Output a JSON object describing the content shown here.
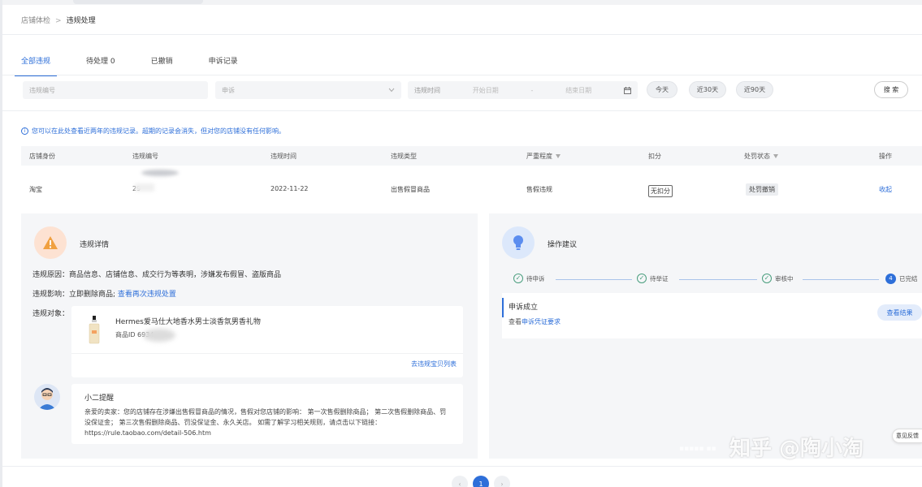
{
  "breadcrumb": {
    "parent": "店铺体检",
    "separator": ">",
    "current": "违规处理"
  },
  "tabs": [
    {
      "label": "全部违规"
    },
    {
      "label": "待处理 0"
    },
    {
      "label": "已撤销"
    },
    {
      "label": "申诉记录"
    }
  ],
  "filters": {
    "id_placeholder": "违规编号",
    "type_value": "申诉",
    "time_label": "违规时间",
    "start_placeholder": "开始日期",
    "range_sep": "-",
    "end_placeholder": "结束日期",
    "quick": [
      "今天",
      "近30天",
      "近90天"
    ],
    "search_label": "搜 索"
  },
  "notice": "您可以在此处查看近两年的违规记录。超期的记录会消失，但对您的店铺没有任何影响。",
  "table": {
    "headers": [
      "店铺身份",
      "违规编号",
      "违规时间",
      "违规类型",
      "严重程度",
      "扣分",
      "处罚状态",
      "操作"
    ],
    "row": {
      "identity": "淘宝",
      "id": "29",
      "time": "2022-11-22",
      "type": "出售假冒商品",
      "severity": "售假违规",
      "points": "无扣分",
      "status": "处罚撤销",
      "action": "收起"
    }
  },
  "detail": {
    "title": "违规详情",
    "reason": "违规原因：商品信息、店铺信息、成交行为等表明，涉嫌发布假冒、盗版商品",
    "impact_prefix": "违规影响：立即删除商品; ",
    "impact_link": "查看再次违规处置",
    "object_label": "违规对象：",
    "product_name": "Hermes爱马仕大地香水男士淡香氛男香礼物",
    "product_id": "商品ID 6934",
    "goto_link": "去违规宝贝列表"
  },
  "reminder": {
    "title": "小二提醒",
    "body": "亲爱的卖家：您的店铺存在涉嫌出售假冒商品的情况，售假对您店铺的影响： 第一次售假删除商品； 第二次售假删除商品、罚没保证金； 第三次售假删除商品、罚没保证金、永久关店。 如需了解学习相关规则，请点击以下链接：https://rule.taobao.com/detail-506.htm"
  },
  "suggestion": {
    "title": "操作建议",
    "steps": [
      "待申诉",
      "待举证",
      "审核中",
      "已完结"
    ],
    "current_step": "4",
    "result_title": "申诉成立",
    "result_prefix": "查看",
    "result_link": "申诉凭证要求",
    "result_button": "查看结果"
  },
  "feedback": "意见反馈",
  "watermark": "知乎 @陶小淘",
  "pager": {
    "prev": "‹",
    "current": "1",
    "next": "›"
  },
  "colors": {
    "accent": "#2e6fd9",
    "warning": "#f0a040",
    "success": "#4a9e7e"
  }
}
